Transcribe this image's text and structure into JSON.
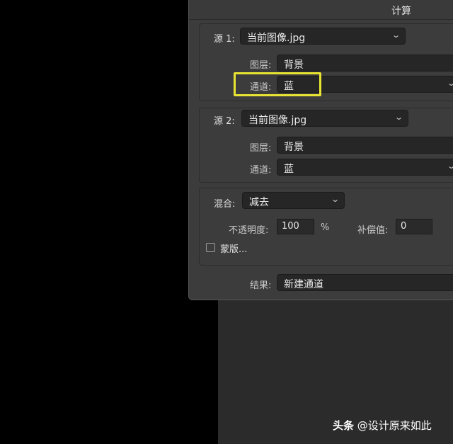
{
  "dialog": {
    "title": "计算",
    "source1": {
      "label": "源 1:",
      "file": "当前图像.jpg",
      "layer_label": "图层:",
      "layer": "背景",
      "channel_label": "通道:",
      "channel": "蓝"
    },
    "source2": {
      "label": "源 2:",
      "file": "当前图像.jpg",
      "layer_label": "图层:",
      "layer": "背景",
      "channel_label": "通道:",
      "channel": "蓝"
    },
    "blend": {
      "label": "混合:",
      "mode": "减去",
      "opacity_label": "不透明度:",
      "opacity": "100",
      "opacity_unit": "%",
      "offset_label": "补偿值:",
      "offset": "0",
      "mask_label": "蒙版..."
    },
    "result": {
      "label": "结果:",
      "value": "新建通道"
    }
  },
  "watermark": {
    "brand": "头条",
    "handle": "@设计原来如此"
  },
  "colors": {
    "highlight": "#e9e431",
    "dialog_bg": "#3c3c3c",
    "field_bg": "#262626"
  }
}
